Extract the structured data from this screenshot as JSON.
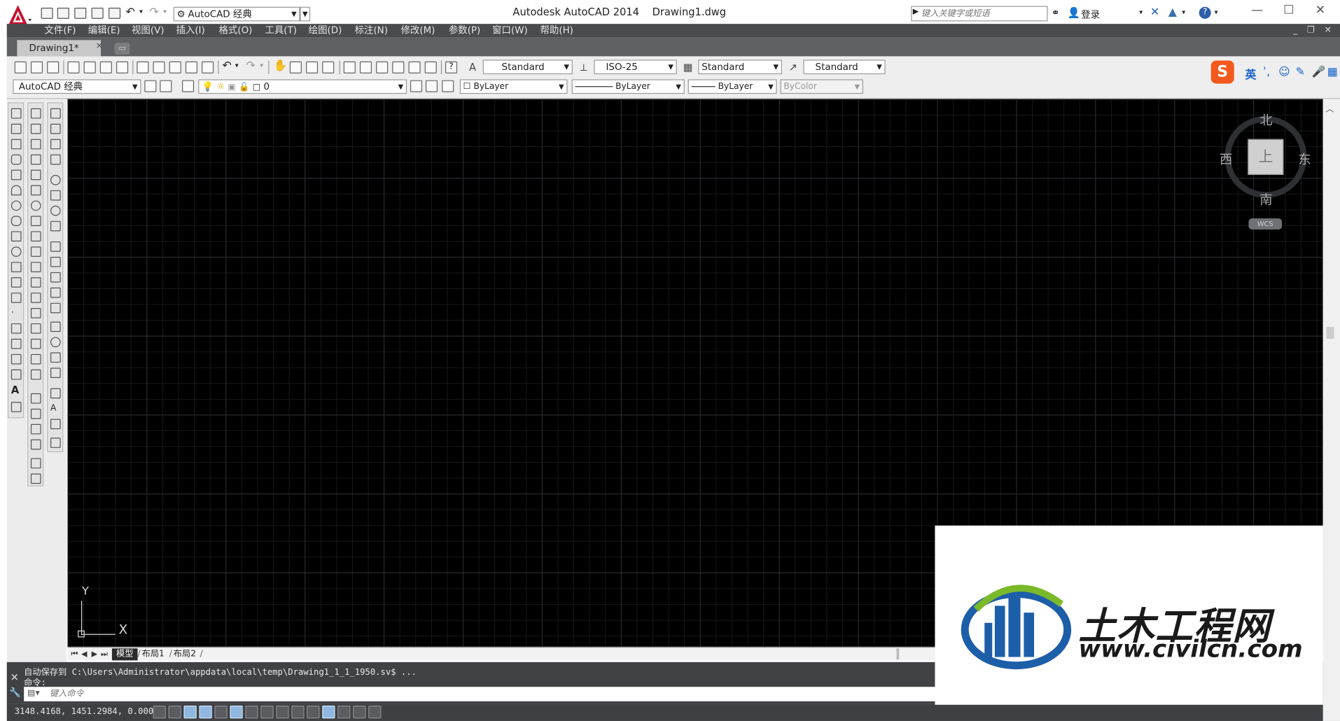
{
  "titlebar": {
    "app_title": "Autodesk AutoCAD 2014",
    "file_name": "Drawing1.dwg",
    "workspace": "AutoCAD 经典",
    "search_placeholder": "键入关键字或短语",
    "login_label": "登录",
    "help_label": "?",
    "window_controls": {
      "minimize": "—",
      "maximize": "☐",
      "close": "✕"
    }
  },
  "menu": {
    "items": [
      "文件(F)",
      "编辑(E)",
      "视图(V)",
      "插入(I)",
      "格式(O)",
      "工具(T)",
      "绘图(D)",
      "标注(N)",
      "修改(M)",
      "参数(P)",
      "窗口(W)",
      "帮助(H)"
    ],
    "doc_controls": "_ ❐ ✕"
  },
  "tabs": {
    "drawing_tab": "Drawing1*",
    "close": "✕"
  },
  "toolbar": {
    "text_style": "Standard",
    "dim_style": "ISO-25",
    "table_style": "Standard",
    "multileader_style": "Standard",
    "workspace_combo": "AutoCAD 经典",
    "layer_combo": "0",
    "color_combo": "ByLayer",
    "linetype_combo": "ByLayer",
    "lineweight_combo": "ByLayer",
    "plotstyle_combo": "ByColor"
  },
  "ime": {
    "logo": "S",
    "lang": "英",
    "icons": [
      "ʾ,",
      "☺",
      "✎",
      "🎤",
      "▦"
    ]
  },
  "viewcube": {
    "north": "北",
    "south": "南",
    "east": "东",
    "west": "西",
    "face": "上",
    "wcs": "WCS"
  },
  "ucs": {
    "x": "X",
    "y": "Y"
  },
  "layout_tabs": [
    "模型",
    "布局1",
    "布局2"
  ],
  "command": {
    "history_1": "自动保存到 C:\\Users\\Administrator\\appdata\\local\\temp\\Drawing1_1_1_1950.sv$ ...",
    "history_2": "命令:",
    "input_placeholder": "键入命令"
  },
  "status": {
    "coordinates": "3148.4168, 1451.2984, 0.0000"
  },
  "watermark": {
    "brand": "土木工程网",
    "url": "www.civilcn.com"
  },
  "colors": {
    "canvas": "#000000",
    "menu_bg": "#494b4e",
    "autocad_red": "#c8102e",
    "ime_orange": "#f3591c",
    "logo_blue": "#1d5ea8",
    "logo_green": "#7ab929"
  }
}
